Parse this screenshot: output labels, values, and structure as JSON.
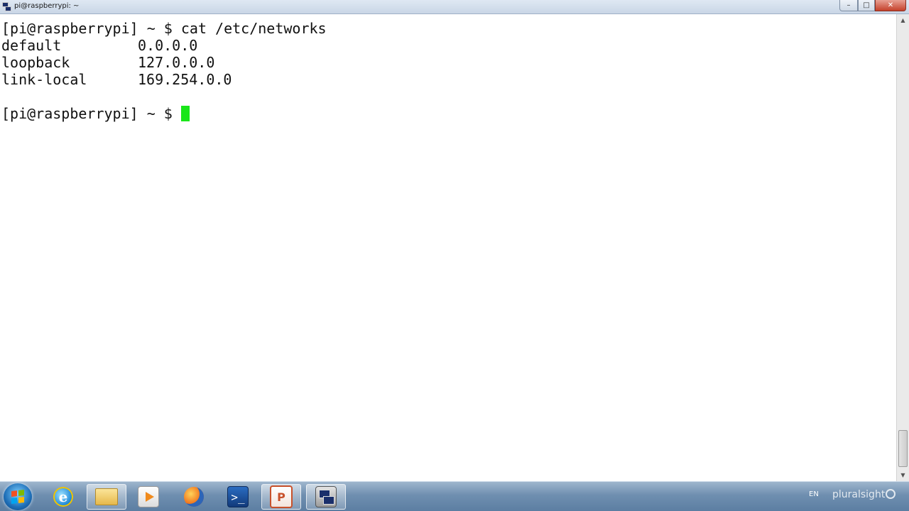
{
  "window": {
    "title": "pi@raspberrypi: ~",
    "close_glyph": "✕",
    "minimize_glyph": "–",
    "maximize_glyph": "□"
  },
  "terminal": {
    "prompt": "[pi@raspberrypi] ~ $ ",
    "command": "cat /etc/networks",
    "output": [
      {
        "name": "default",
        "address": "0.0.0.0"
      },
      {
        "name": "loopback",
        "address": "127.0.0.0"
      },
      {
        "name": "link-local",
        "address": "169.254.0.0"
      }
    ],
    "cursor_color": "#19e619"
  },
  "taskbar": {
    "apps": [
      {
        "icon": "internet-explorer-icon",
        "label": "e"
      },
      {
        "icon": "folder-icon"
      },
      {
        "icon": "media-player-icon"
      },
      {
        "icon": "firefox-icon"
      },
      {
        "icon": "powershell-icon",
        "label": ">_"
      },
      {
        "icon": "powerpoint-icon",
        "label": "P"
      },
      {
        "icon": "putty-icon"
      }
    ],
    "language": "EN",
    "watermark": "pluralsight"
  }
}
